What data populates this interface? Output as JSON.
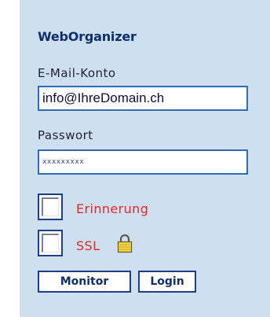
{
  "panel": {
    "title": "WebOrganizer",
    "email": {
      "label": "E-Mail-Konto",
      "value": "info@IhreDomain.ch"
    },
    "password": {
      "label": "Passwort",
      "masked_value": "xxxxxxxxx"
    },
    "remember": {
      "label": "Erinnerung",
      "checked": false
    },
    "ssl": {
      "label": "SSL",
      "checked": false,
      "icon": "lock-icon"
    },
    "buttons": {
      "monitor": "Monitor",
      "login": "Login"
    }
  },
  "colors": {
    "panel_bg": "#cedff0",
    "title": "#0e2f6b",
    "field_border": "#2f6cb5",
    "checkbox_label": "#e02828",
    "button_border": "#1c3f88"
  }
}
